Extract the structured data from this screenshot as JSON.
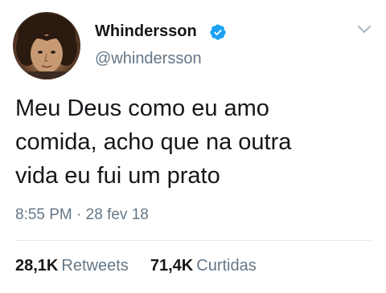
{
  "author": {
    "display_name": "Whindersson",
    "handle": "@whindersson",
    "verified": true,
    "avatar_icon": "profile-photo"
  },
  "tweet": {
    "lines": [
      "Meu Deus como eu amo",
      "comida, acho que na outra",
      "vida eu fui um prato"
    ],
    "time": "8:55 PM",
    "separator": "·",
    "date": "28 fev 18"
  },
  "stats": {
    "retweets_count": "28,1K",
    "retweets_label": "Retweets",
    "likes_count": "71,4K",
    "likes_label": "Curtidas"
  },
  "colors": {
    "text": "#14171a",
    "secondary": "#657786",
    "verified_badge": "#1da1f2",
    "divider": "#e1e8ed"
  },
  "icons": {
    "verified": "verified-badge-icon",
    "menu": "chevron-down-icon"
  }
}
